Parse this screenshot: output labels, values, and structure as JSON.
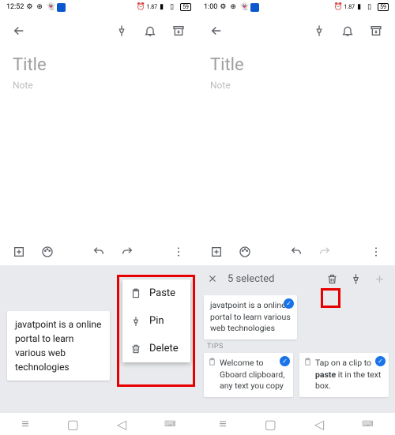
{
  "left": {
    "status": {
      "time": "12:52"
    },
    "title_placeholder": "Title",
    "note_placeholder": "Note",
    "clip_text": "javatpoint is a online portal to learn various web technologies",
    "menu": {
      "paste": "Paste",
      "pin": "Pin",
      "del": "Delete"
    }
  },
  "right": {
    "status": {
      "time": "1:00"
    },
    "title_placeholder": "Title",
    "note_placeholder": "Note",
    "selected_text": "5 selected",
    "clip1": "javatpoint is a online portal to learn various web technologies",
    "tips_label": "TIPS",
    "tip1": "Welcome to Gboard clipboard, any text you copy",
    "tip2_a": "Tap on a clip to ",
    "tip2_b": "paste",
    "tip2_c": " it in the text box."
  }
}
